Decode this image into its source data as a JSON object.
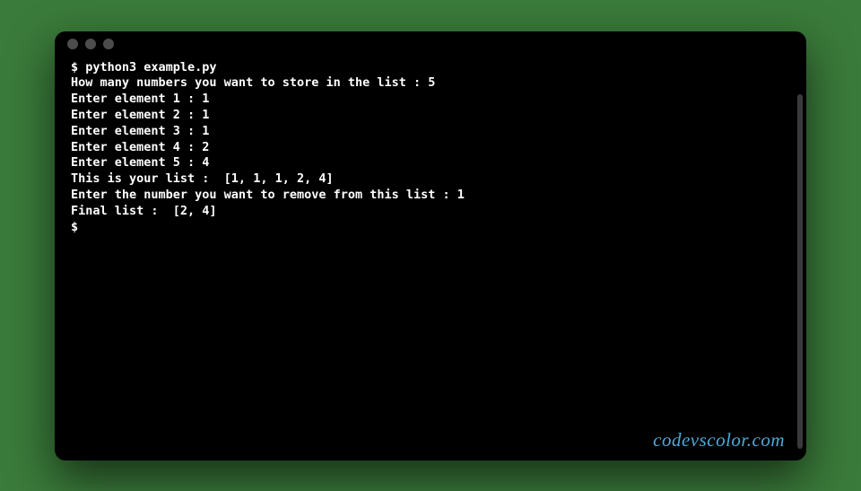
{
  "terminal": {
    "lines": [
      "$ python3 example.py",
      "How many numbers you want to store in the list : 5",
      "Enter element 1 : 1",
      "Enter element 2 : 1",
      "Enter element 3 : 1",
      "Enter element 4 : 2",
      "Enter element 5 : 4",
      "This is your list :  [1, 1, 1, 2, 4]",
      "Enter the number you want to remove from this list : 1",
      "Final list :  [2, 4]",
      "$"
    ]
  },
  "watermark": "codevscolor.com"
}
